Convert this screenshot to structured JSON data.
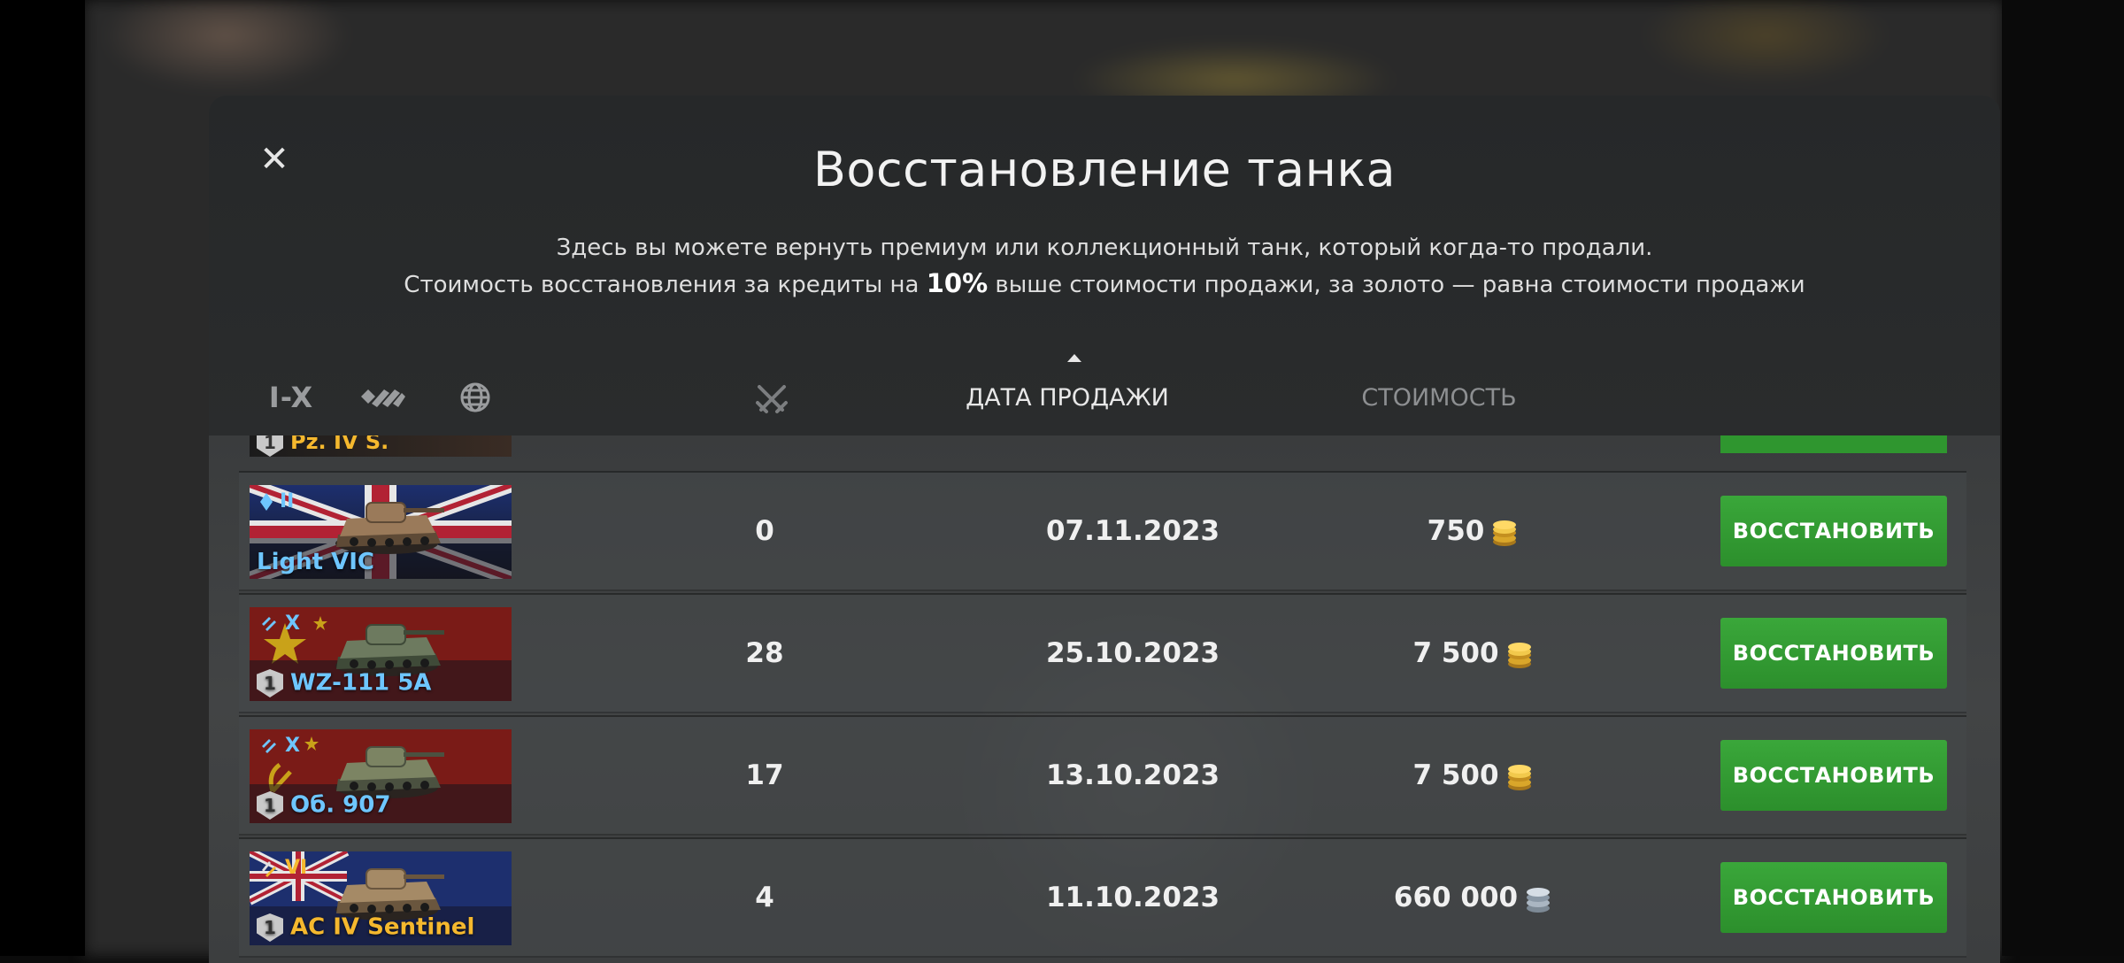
{
  "dialog": {
    "title": "Восстановление танка",
    "description_line1": "Здесь вы можете вернуть премиум или коллекционный танк, который когда-то продали.",
    "description_line2_before": "Стоимость восстановления за кредиты на ",
    "description_line2_bold": "10%",
    "description_line2_after": " выше стоимости продажи, за золото — равна стоимости продажи",
    "close_icon": "close-icon"
  },
  "filters": {
    "tier_label": "I-X",
    "type_icon": "tank-type-icon",
    "nation_icon": "globe-icon"
  },
  "columns": {
    "battles_icon": "crossed-swords-icon",
    "sale_date": "ДАТА ПРОДАЖИ",
    "cost": "СТОИМОСТЬ",
    "sorted_by": "sale_date",
    "sort_direction": "ascending"
  },
  "partial_row": {
    "badge": "1",
    "name": "Pz. IV S."
  },
  "rows": [
    {
      "tier_icon": "premium-diamond-icon",
      "tier": "II",
      "name": "Light VIC",
      "name_color": "#6ec6ff",
      "badge": "",
      "battles": "0",
      "date": "07.11.2023",
      "cost": "750",
      "currency": "gold",
      "currency_icon": "gold-coin-icon",
      "button": "ВОССТАНОВИТЬ",
      "flag": "uk"
    },
    {
      "tier_icon": "collector-icon",
      "tier": "X",
      "name": "WZ-111 5A",
      "name_color": "#6ec6ff",
      "badge": "1",
      "battles": "28",
      "date": "25.10.2023",
      "cost": "7 500",
      "currency": "gold",
      "currency_icon": "gold-coin-icon",
      "button": "ВОССТАНОВИТЬ",
      "flag": "china"
    },
    {
      "tier_icon": "collector-icon",
      "tier": "X",
      "name": "Об. 907",
      "name_color": "#6ec6ff",
      "badge": "1",
      "battles": "17",
      "date": "13.10.2023",
      "cost": "7 500",
      "currency": "gold",
      "currency_icon": "gold-coin-icon",
      "button": "ВОССТАНОВИТЬ",
      "flag": "ussr"
    },
    {
      "tier_icon": "premium-icon",
      "tier": "VI",
      "name": "AC IV Sentinel",
      "name_color": "#f5b82e",
      "badge": "1",
      "battles": "4",
      "date": "11.10.2023",
      "cost": "660 000",
      "currency": "credits",
      "currency_icon": "silver-coin-icon",
      "button": "ВОССТАНОВИТЬ",
      "flag": "australia"
    }
  ],
  "colors": {
    "button_green": "#32a032",
    "premium_blue": "#6ec6ff",
    "premium_gold": "#f5b82e",
    "modal_bg": "#2c2e2f"
  }
}
